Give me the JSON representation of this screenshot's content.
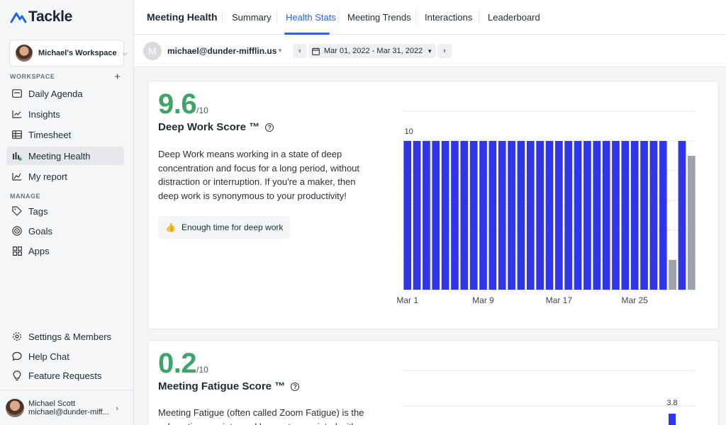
{
  "app": {
    "name": "Tackle"
  },
  "workspace": {
    "name": "Michael's Workspace"
  },
  "sidebar": {
    "workspace_label": "WORKSPACE",
    "manage_label": "MANAGE",
    "workspace_items": [
      {
        "label": "Daily Agenda",
        "icon": "agenda-icon"
      },
      {
        "label": "Insights",
        "icon": "insights-icon"
      },
      {
        "label": "Timesheet",
        "icon": "timesheet-icon"
      },
      {
        "label": "Meeting Health",
        "icon": "meeting-health-icon",
        "active": true
      },
      {
        "label": "My report",
        "icon": "report-icon"
      }
    ],
    "manage_items": [
      {
        "label": "Tags",
        "icon": "tag-icon"
      },
      {
        "label": "Goals",
        "icon": "target-icon"
      },
      {
        "label": "Apps",
        "icon": "apps-icon"
      }
    ],
    "bottom_items": [
      {
        "label": "Settings & Members",
        "icon": "gear-icon"
      },
      {
        "label": "Help Chat",
        "icon": "chat-icon"
      },
      {
        "label": "Feature Requests",
        "icon": "lightbulb-icon"
      }
    ],
    "user": {
      "name": "Michael Scott",
      "email": "michael@dunder-miff..."
    }
  },
  "header": {
    "title": "Meeting Health",
    "tabs": [
      "Summary",
      "Health Stats",
      "Meeting Trends",
      "Interactions",
      "Leaderboard"
    ],
    "active_tab": "Health Stats"
  },
  "filters": {
    "avatar_letter": "M",
    "email": "michael@dunder-mifflin.us",
    "date_range": "Mar 01, 2022 - Mar 31, 2022"
  },
  "cards": [
    {
      "score": "9.6",
      "max": "/10",
      "title": "Deep Work Score ™",
      "description": "Deep Work means working in a state of deep concentration and focus for a long period, without distraction or interruption. If you're a maker, then deep work is synonymous to your productivity!",
      "badge": {
        "emoji": "👍",
        "label": "Enough time for deep work"
      }
    },
    {
      "score": "0.2",
      "max": "/10",
      "title": "Meeting Fatigue Score ™",
      "description": "Meeting Fatigue (often called Zoom Fatigue) is the exhaustion, anxiety, and burnout associated with"
    }
  ],
  "colors": {
    "accent": "#2463eb",
    "score_green": "#3fa46a",
    "bar_blue": "#2f35e8",
    "bar_gray": "#9ca3af"
  },
  "chart_data": [
    {
      "type": "bar",
      "ylim": [
        0,
        12
      ],
      "x_tick_labels": [
        "Mar 1",
        "Mar 9",
        "Mar 17",
        "Mar 25"
      ],
      "data_labels": [
        "10"
      ],
      "series": [
        {
          "color": "#2f35e8",
          "values": [
            10,
            10,
            10,
            10,
            10,
            10,
            10,
            10,
            10,
            10,
            10,
            10,
            10,
            10,
            10,
            10,
            10,
            10,
            10,
            10,
            10,
            10,
            10,
            10,
            10,
            10,
            10,
            10,
            null,
            10,
            null
          ]
        },
        {
          "color": "#9ca3af",
          "values": [
            null,
            null,
            null,
            null,
            null,
            null,
            null,
            null,
            null,
            null,
            null,
            null,
            null,
            null,
            null,
            null,
            null,
            null,
            null,
            null,
            null,
            null,
            null,
            null,
            null,
            null,
            null,
            null,
            2,
            null,
            9
          ]
        }
      ]
    },
    {
      "type": "bar",
      "data_labels": [
        "3.8"
      ],
      "visible_values": [
        {
          "value": 3.8
        }
      ]
    }
  ]
}
